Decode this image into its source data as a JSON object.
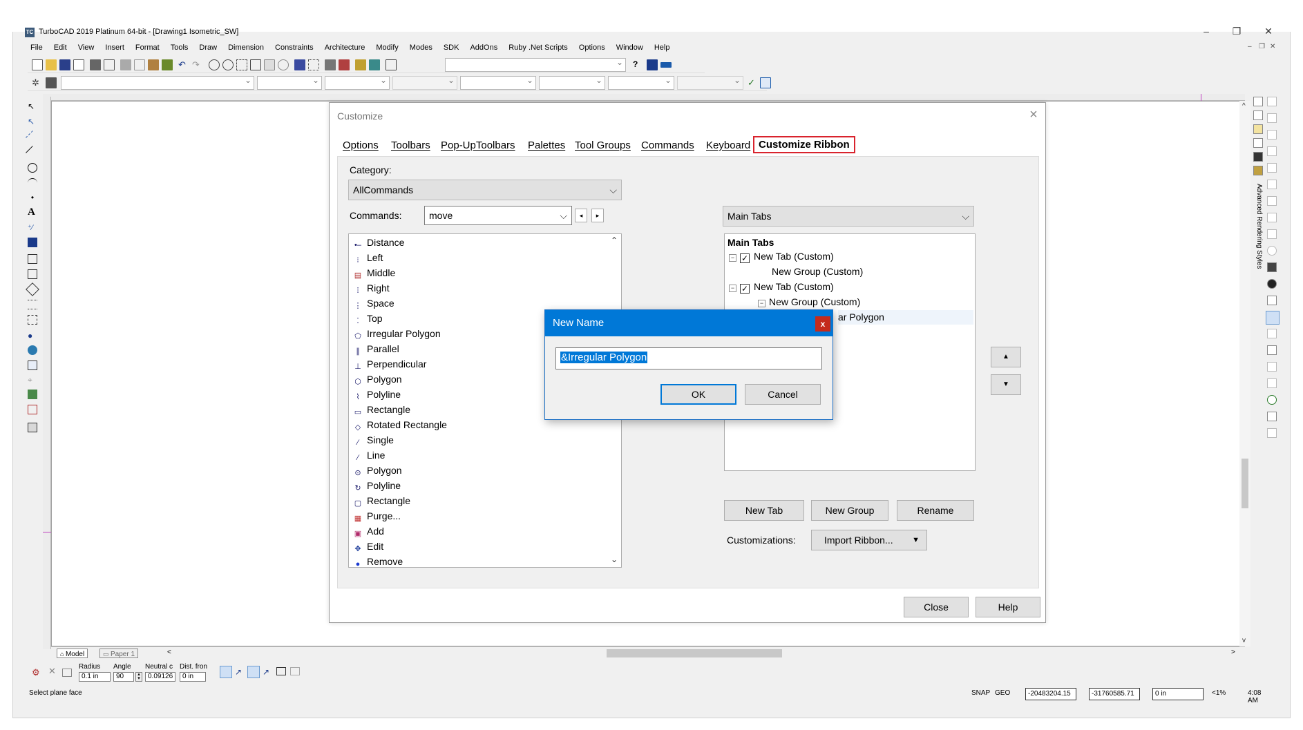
{
  "app": {
    "title": "TurboCAD 2019 Platinum 64-bit - [Drawing1 Isometric_SW]",
    "icon_text": "TC",
    "window_controls": [
      "–",
      "❐",
      "✕"
    ],
    "mdi_controls": [
      "–",
      "❐",
      "✕"
    ]
  },
  "menubar": [
    "File",
    "Edit",
    "View",
    "Insert",
    "Format",
    "Tools",
    "Draw",
    "Dimension",
    "Constraints",
    "Architecture",
    "Modify",
    "Modes",
    "SDK",
    "AddOns",
    "Ruby .Net Scripts",
    "Options",
    "Window",
    "Help"
  ],
  "right_panel": {
    "label": "Advanced Rendering Styles"
  },
  "sheet_tabs": {
    "model": "Model",
    "paper": "Paper 1"
  },
  "inspector": {
    "radius_label": "Radius",
    "radius_value": "0.1 in",
    "angle_label": "Angle",
    "angle_value": "90",
    "neutral_label": "Neutral c",
    "neutral_value": "0.09126",
    "dist_label": "Dist. fron",
    "dist_value": "0 in"
  },
  "status": {
    "prompt": "Select plane face",
    "snap": "SNAP",
    "geo": "GEO",
    "x_value": "-20483204.15",
    "y_value": "-31760585.71",
    "z_value": "0 in",
    "zoom": "<1%",
    "time": "4:08 AM"
  },
  "customize": {
    "title": "Customize",
    "tabs": [
      "Options",
      "Toolbars",
      "Pop-UpToolbars",
      "Palettes",
      "Tool Groups",
      "Commands",
      "Keyboard",
      "Customize Ribbon"
    ],
    "active_tab": "Customize Ribbon",
    "category_label": "Category:",
    "category_value": "AllCommands",
    "commands_label": "Commands:",
    "commands_value": "move",
    "command_list": [
      {
        "icon": "distance-icon",
        "label": "Distance"
      },
      {
        "icon": "align-left-icon",
        "label": "Left"
      },
      {
        "icon": "align-middle-icon",
        "label": "Middle"
      },
      {
        "icon": "align-right-icon",
        "label": "Right"
      },
      {
        "icon": "space-icon",
        "label": "Space"
      },
      {
        "icon": "align-top-icon",
        "label": "Top"
      },
      {
        "icon": "irregular-polygon-icon",
        "label": "Irregular Polygon"
      },
      {
        "icon": "parallel-icon",
        "label": "Parallel"
      },
      {
        "icon": "perpendicular-icon",
        "label": "Perpendicular"
      },
      {
        "icon": "polygon-icon",
        "label": "Polygon"
      },
      {
        "icon": "polyline-icon",
        "label": "Polyline"
      },
      {
        "icon": "rectangle-icon",
        "label": "Rectangle"
      },
      {
        "icon": "rotated-rectangle-icon",
        "label": "Rotated Rectangle"
      },
      {
        "icon": "single-line-icon",
        "label": "Single"
      },
      {
        "icon": "line-icon",
        "label": "Line"
      },
      {
        "icon": "polygon-icon",
        "label": "Polygon"
      },
      {
        "icon": "polyline-icon",
        "label": "Polyline"
      },
      {
        "icon": "rectangle-icon",
        "label": "Rectangle"
      },
      {
        "icon": "purge-icon",
        "label": "Purge..."
      },
      {
        "icon": "add-icon",
        "label": "Add"
      },
      {
        "icon": "edit-icon",
        "label": "Edit"
      },
      {
        "icon": "remove-icon",
        "label": "Remove"
      }
    ],
    "ribbon_dropdown": "Main Tabs",
    "tree": {
      "root": "Main Tabs",
      "rows": [
        "New Tab (Custom)",
        "New Group (Custom)",
        "New Tab (Custom)",
        "New Group (Custom)",
        "ar Polygon"
      ]
    },
    "buttons": {
      "new_tab": "New Tab",
      "new_group": "New Group",
      "rename": "Rename",
      "customizations_label": "Customizations:",
      "import": "Import Ribbon...",
      "close": "Close",
      "help": "Help",
      "move_up": "▲",
      "move_down": "▼"
    }
  },
  "new_name": {
    "title": "New Name",
    "close": "x",
    "value": "&Irregular Polygon",
    "ok": "OK",
    "cancel": "Cancel"
  },
  "colors": {
    "accent": "#0078d7",
    "active_tab_border": "#d9232d",
    "dialog_close": "#c42b1c"
  }
}
